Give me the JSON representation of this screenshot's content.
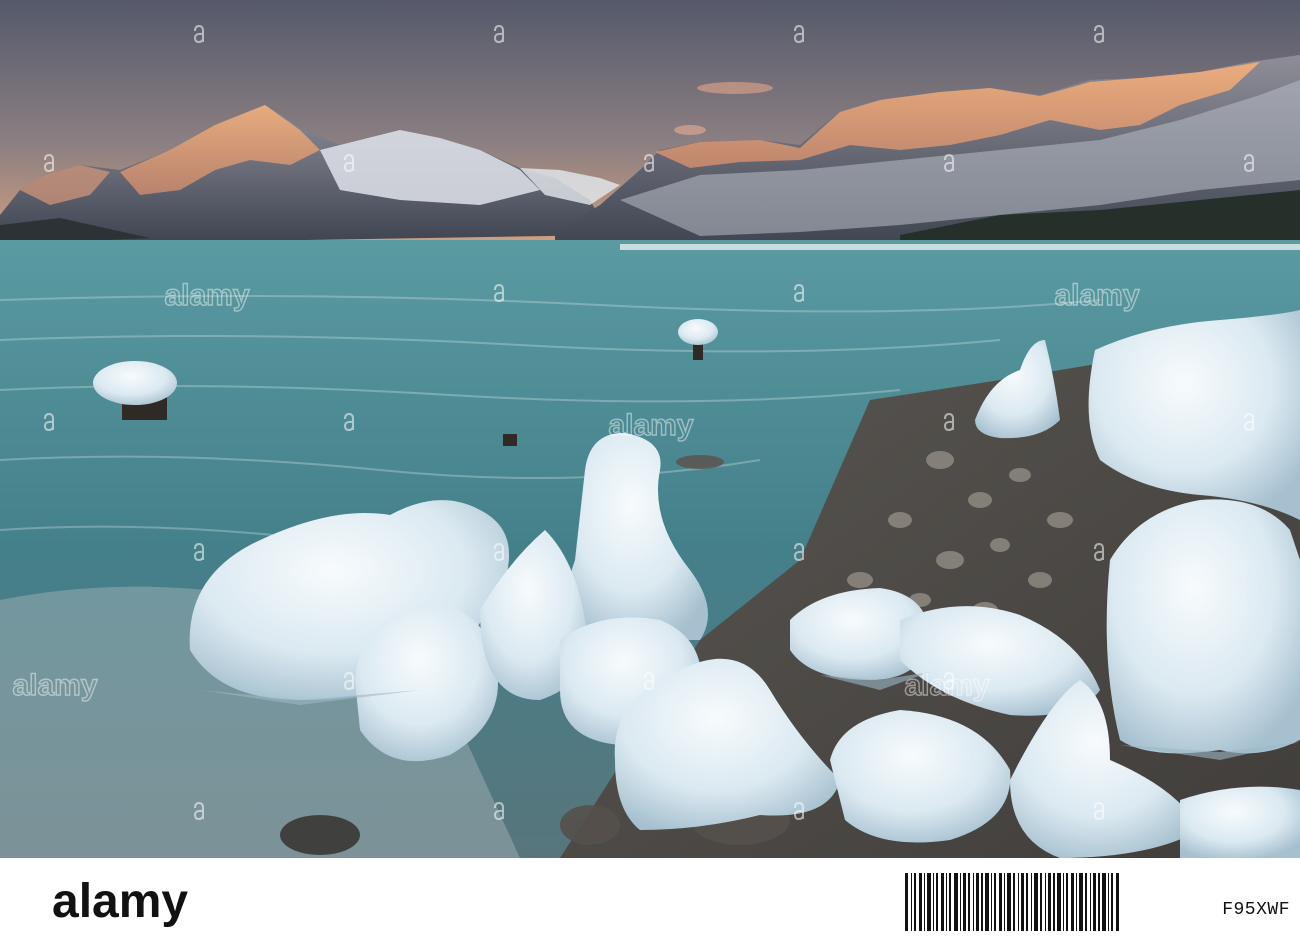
{
  "scene": {
    "kind": "photograph",
    "subject": "frozen lakeshore with ice-encrusted boulders and stumps, turquoise lake, alpenglow on snowy mountains at dusk",
    "palette": {
      "sky_top": "#5b5e6b",
      "sky_horizon": "#d9a27c",
      "alpenglow": "#f0a26c",
      "snow": "#e8edf2",
      "lake": "#4f8f97",
      "lake_deep": "#355f68",
      "ice": "#e6f2f8",
      "ice_shadow": "#a9c4d4",
      "rocks": "#6c6863",
      "forest": "#2b3530"
    }
  },
  "watermark": {
    "brand_text": "alamy",
    "icons": [
      "alamy-a-icon",
      "alamy-wordmark"
    ]
  },
  "footer": {
    "brand_text": "alamy",
    "image_id": "F95XWF"
  }
}
